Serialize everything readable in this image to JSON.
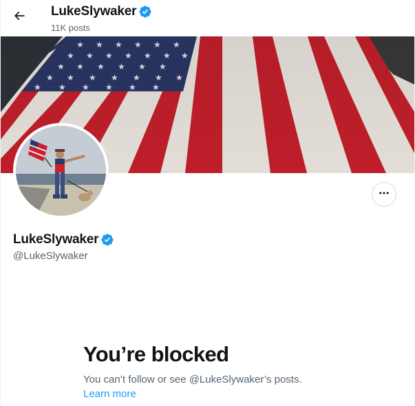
{
  "header": {
    "display_name": "LukeSlywaker",
    "post_count": "11K posts"
  },
  "profile": {
    "display_name": "LukeSlywaker",
    "handle": "@LukeSlywaker",
    "verified": true
  },
  "blocked": {
    "title": "You’re blocked",
    "message": "You can’t follow or see @LukeSlywaker’s posts.",
    "learn_more": "Learn more"
  },
  "icons": {
    "back": "arrow-left-icon",
    "verified": "verified-badge-icon",
    "more": "more-horizontal-icon"
  },
  "colors": {
    "accent": "#1d9bf0",
    "text_primary": "#0f1419",
    "text_secondary": "#536471",
    "flag_red": "#c8202c",
    "flag_blue": "#2b3768"
  }
}
